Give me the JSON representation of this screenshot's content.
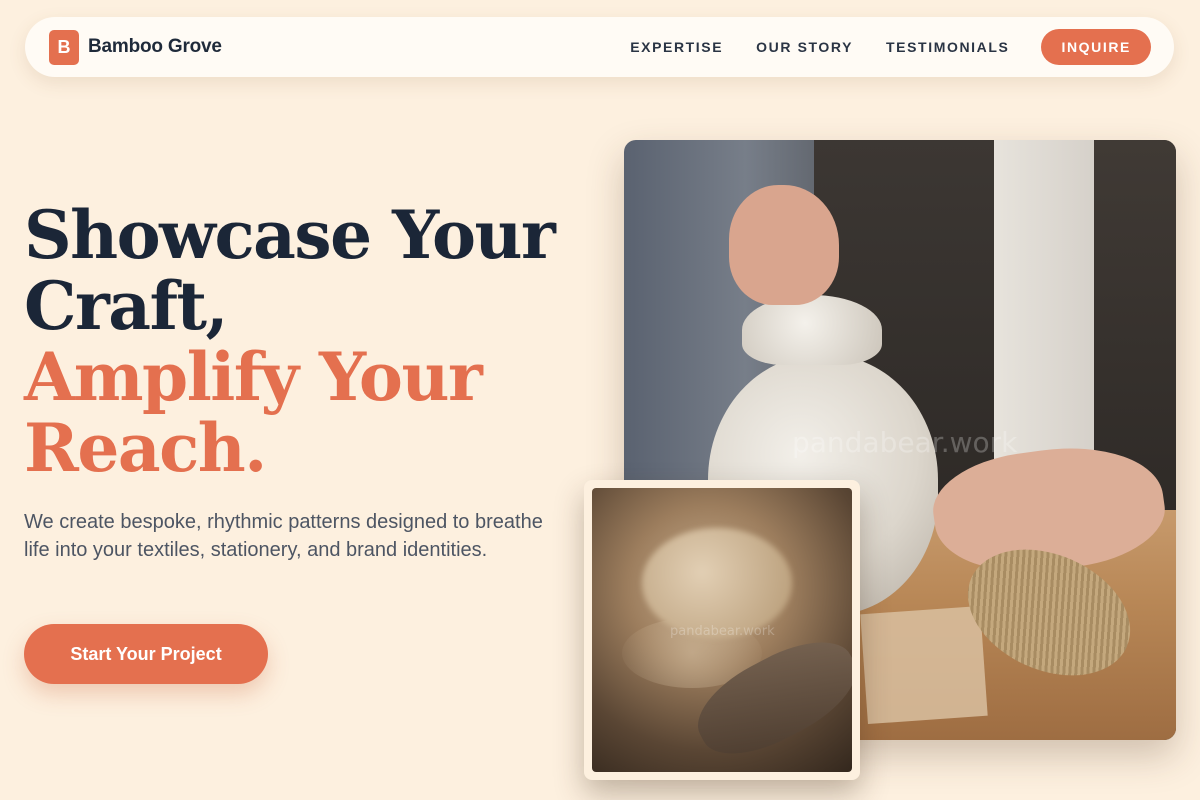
{
  "nav": {
    "brand_initial": "B",
    "brand_name": "Bamboo Grove",
    "links": [
      "EXPERTISE",
      "OUR STORY",
      "TESTIMONIALS"
    ],
    "cta": "INQUIRE"
  },
  "hero": {
    "title_line1": "Showcase Your",
    "title_line2": "Craft,",
    "title_line3": "Amplify Your",
    "title_line4": "Reach.",
    "subtitle": "We create bespoke, rhythmic patterns designed to breathe life into your textiles, stationery, and brand identities.",
    "cta": "Start Your Project"
  },
  "images": {
    "main_watermark": "pandabear.work",
    "inset_watermark": "pandabear.work"
  },
  "colors": {
    "background": "#fdf0df",
    "accent": "#e4704f",
    "heading": "#1b2637",
    "body_text": "#4d5563"
  }
}
